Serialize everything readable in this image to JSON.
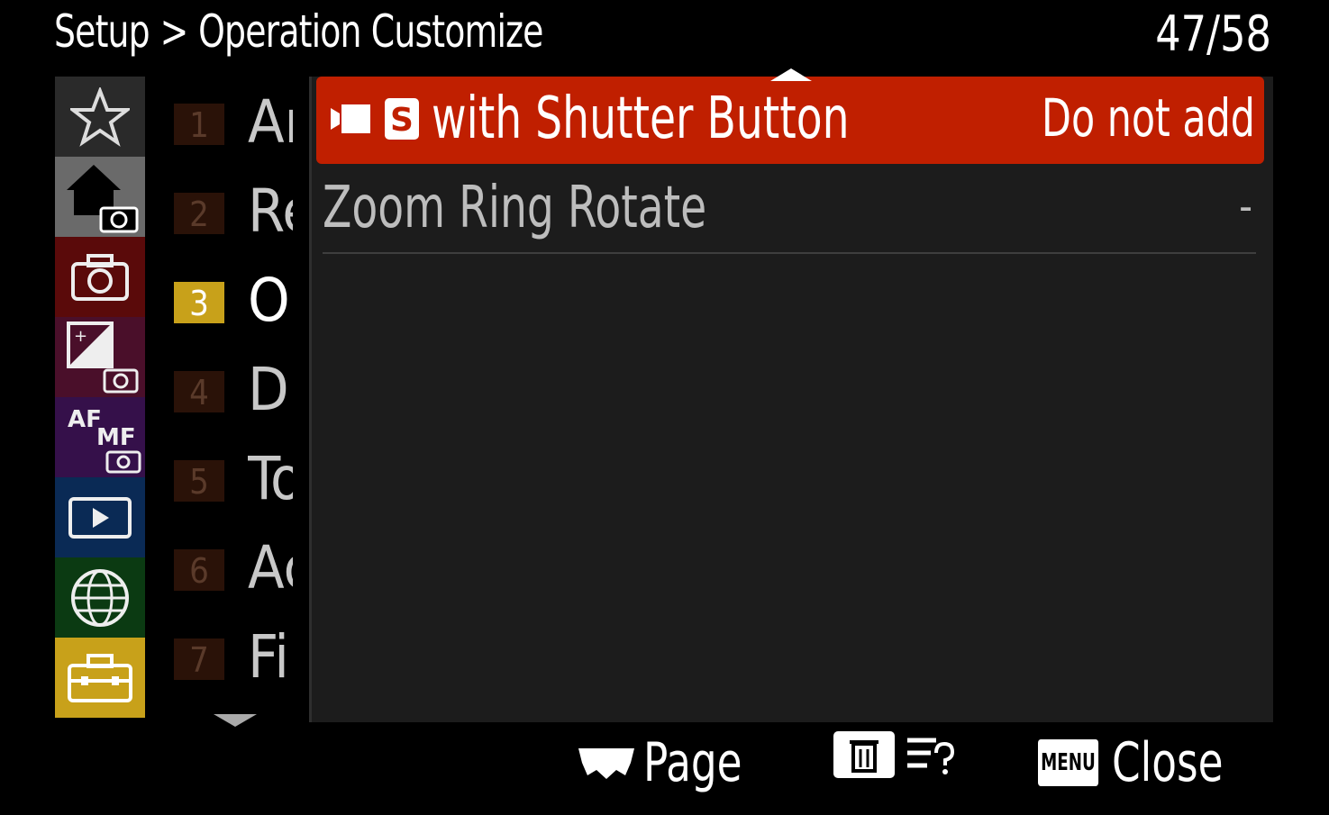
{
  "header": {
    "section": "Setup",
    "separator": ">",
    "page_title": "Operation Customize",
    "page_counter": "47/58"
  },
  "categories": [
    {
      "icon": "star-icon",
      "bg": "#2a2a2a"
    },
    {
      "icon": "home-camera-icon",
      "bg": "#6a6a6a"
    },
    {
      "icon": "camera-icon",
      "bg": "#5a0a0a"
    },
    {
      "icon": "exposure-camera-icon",
      "bg": "#4a0f2a"
    },
    {
      "icon": "af-mf-camera-icon",
      "bg": "#35104a",
      "text": "AF",
      "subtext": "MF"
    },
    {
      "icon": "playback-icon",
      "bg": "#0a2a55"
    },
    {
      "icon": "globe-icon",
      "bg": "#0b3a12"
    },
    {
      "icon": "toolbox-icon",
      "bg": "#c8a11a"
    }
  ],
  "subpages": [
    {
      "number": "1",
      "title": "Ar"
    },
    {
      "number": "2",
      "title": "Re"
    },
    {
      "number": "3",
      "title": "Op",
      "selected": true
    },
    {
      "number": "4",
      "title": "Di"
    },
    {
      "number": "5",
      "title": "To"
    },
    {
      "number": "6",
      "title": "Ac"
    },
    {
      "number": "7",
      "title": "Fi"
    }
  ],
  "settings": [
    {
      "label": "with Shutter Button",
      "value": "Do not add",
      "icons": [
        "movie-rec-icon",
        "s-mode-icon"
      ],
      "s_glyph": "S"
    },
    {
      "label": "Zoom Ring Rotate",
      "value": "-"
    }
  ],
  "footer": {
    "page_label": "Page",
    "menu_badge": "MENU",
    "close_label": "Close"
  },
  "colors": {
    "selected_row": "#c01f00",
    "selected_tab": "#c8a11a",
    "panel": "#1c1c1c"
  }
}
